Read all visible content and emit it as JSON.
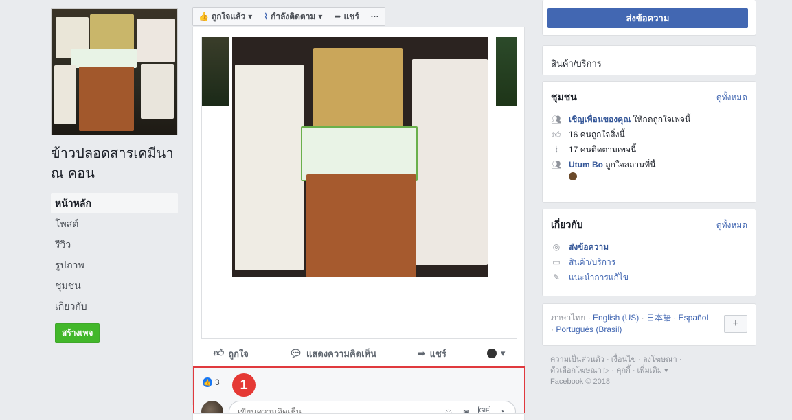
{
  "left": {
    "page_name": "ข้าวปลอดสารเคมีนา ณ คอน",
    "nav": [
      "หน้าหลัก",
      "โพสต์",
      "รีวิว",
      "รูปภาพ",
      "ชุมชน",
      "เกี่ยวกับ"
    ],
    "create_page": "สร้างเพจ"
  },
  "toolbar": {
    "liked": "ถูกใจแล้ว",
    "following": "กำลังติดตาม",
    "share": "แชร์",
    "more": "···"
  },
  "post": {
    "actions": {
      "like": "ถูกใจ",
      "comment": "แสดงความคิดเห็น",
      "share": "แชร์"
    },
    "reaction_count": "3",
    "annotation_badge": "1",
    "comment_placeholder": "เขียนความคิดเห็น..."
  },
  "right": {
    "send_message": "ส่งข้อความ",
    "category": "สินค้า/บริการ",
    "community": {
      "title": "ชุมชน",
      "see_all": "ดูทั้งหมด",
      "invite_link": "เชิญเพื่อนของคุณ",
      "invite_text": " ให้กดถูกใจเพจนี้",
      "likes": "16 คนถูกใจสิ่งนี้",
      "follows": "17 คนติดตามเพจนี้",
      "user": "Utum Bo",
      "user_text": " ถูกใจสถานที่นี้"
    },
    "about": {
      "title": "เกี่ยวกับ",
      "see_all": "ดูทั้งหมด",
      "message": "ส่งข้อความ",
      "category": "สินค้า/บริการ",
      "suggest": "แนะนำการแก้ไข"
    },
    "lang": {
      "thai": "ภาษาไทย",
      "en": "English (US)",
      "ja": "日本語",
      "es": "Español",
      "pt": "Português (Brasil)",
      "plus": "+"
    },
    "footer": {
      "line1": "ความเป็นส่วนตัว · เงื่อนไข · ลงโฆษณา ·",
      "line2": "ตัวเลือกโฆษณา ▷ · คุกกี้ · เพิ่มเติม ▾",
      "line3": "Facebook © 2018"
    }
  }
}
